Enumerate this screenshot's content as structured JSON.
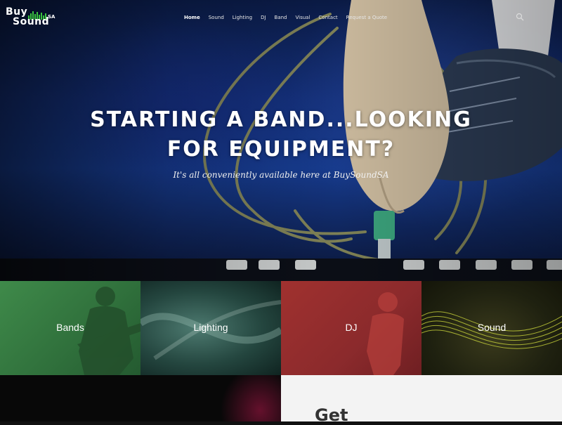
{
  "brand": {
    "line1": "Buy",
    "line2": "Sound",
    "suffix": "SA"
  },
  "nav": {
    "items": [
      {
        "label": "Home",
        "active": true
      },
      {
        "label": "Sound",
        "active": false
      },
      {
        "label": "Lighting",
        "active": false
      },
      {
        "label": "DJ",
        "active": false
      },
      {
        "label": "Band",
        "active": false
      },
      {
        "label": "Visual",
        "active": false
      },
      {
        "label": "Contact",
        "active": false
      },
      {
        "label": "Request a Quote",
        "active": false
      }
    ],
    "search_icon": "search-icon"
  },
  "hero": {
    "title": "Starting a band...looking for equipment?",
    "subtitle": "It's all conveniently available here at BuySoundSA"
  },
  "tiles": [
    {
      "label": "Bands",
      "color": "#3f8a4a"
    },
    {
      "label": "Lighting",
      "color": "#2f5a52"
    },
    {
      "label": "DJ",
      "color": "#a0312f"
    },
    {
      "label": "Sound",
      "color": "#2a2c14"
    }
  ],
  "section": {
    "heading": "Get"
  },
  "colors": {
    "logo_accent": "#39c43f",
    "hero_blue": "#163a8c",
    "panel_bg": "#f3f3f3"
  }
}
